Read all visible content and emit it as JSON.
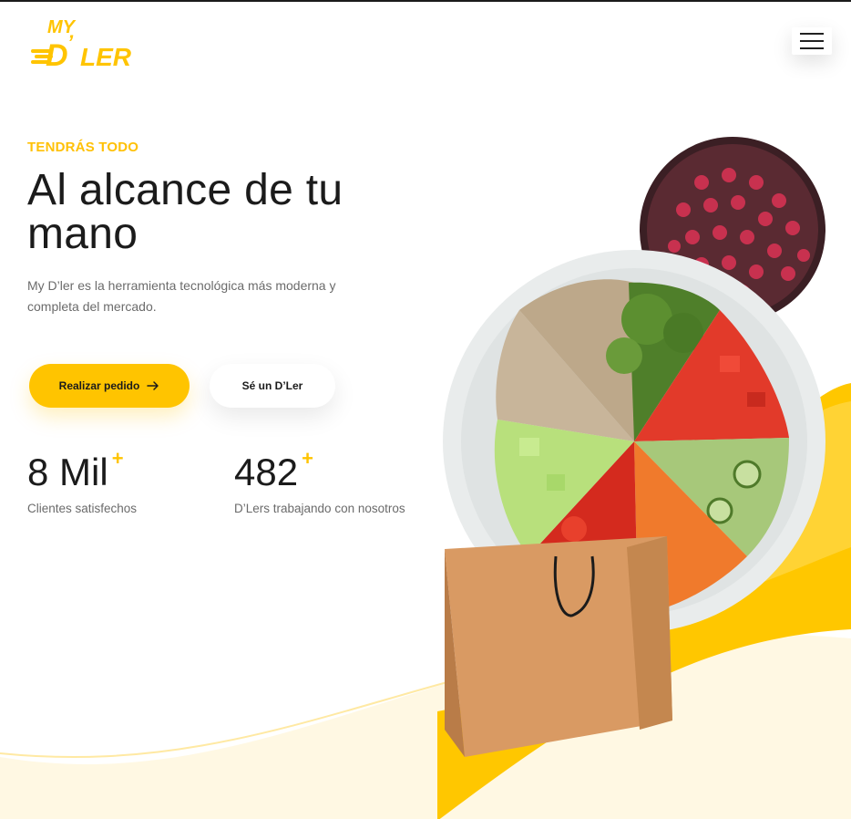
{
  "brand": {
    "name": "MY D'LER",
    "logo_top": "MY",
    "logo_bottom": "D'LER"
  },
  "header": {
    "menu_icon": "hamburger-icon"
  },
  "hero": {
    "eyebrow": "TENDRÁS TODO",
    "headline": "Al alcance de tu mano",
    "description": "My D’ler es la herramienta tecnológica más moderna y completa del mercado.",
    "primary_button": "Realizar pedido",
    "primary_button_icon": "arrow-right-icon",
    "secondary_button": "Sé un D’Ler"
  },
  "stats": [
    {
      "value": "8 Mil",
      "suffix": "+",
      "label": "Clientes satisfechos"
    },
    {
      "value": "482",
      "suffix": "+",
      "label": "D’Lers trabajando con nosotros"
    }
  ],
  "colors": {
    "accent": "#ffc400",
    "text": "#1b1b1b",
    "muted": "#6b6b6b"
  }
}
